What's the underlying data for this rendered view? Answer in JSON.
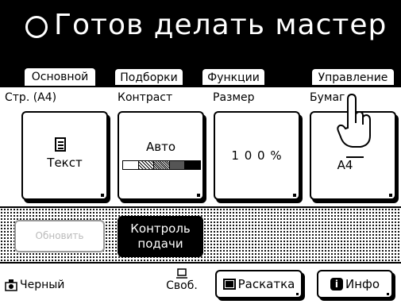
{
  "header": {
    "status_text": "Готов делать мастер"
  },
  "tabs": [
    {
      "label": "Основной",
      "active": true
    },
    {
      "label": "Подборки",
      "active": false
    },
    {
      "label": "Функции",
      "active": false
    },
    {
      "label": "Управление",
      "active": false
    }
  ],
  "columns": {
    "page": {
      "label": "Стр. (A4)",
      "value": "Текст",
      "icon": "document-icon"
    },
    "contrast": {
      "label": "Контраст",
      "value": "Авто",
      "levels": 5,
      "selected_level": 5
    },
    "size": {
      "label": "Размер",
      "value": "1 0 0 %"
    },
    "paper": {
      "label": "Бумаг",
      "value": "A4",
      "icon": "paper-tray-icon"
    }
  },
  "actions": {
    "update_label": "Обновить",
    "feed_control_line1": "Контроль",
    "feed_control_line2": "подачи"
  },
  "bottom": {
    "ink_label": "Черный",
    "free_label": "Своб.",
    "collate_label": "Раскатка",
    "info_label": "Инфо"
  },
  "colors": {
    "background": "#ffffff",
    "foreground": "#000000",
    "disabled": "#bbbbbb"
  }
}
